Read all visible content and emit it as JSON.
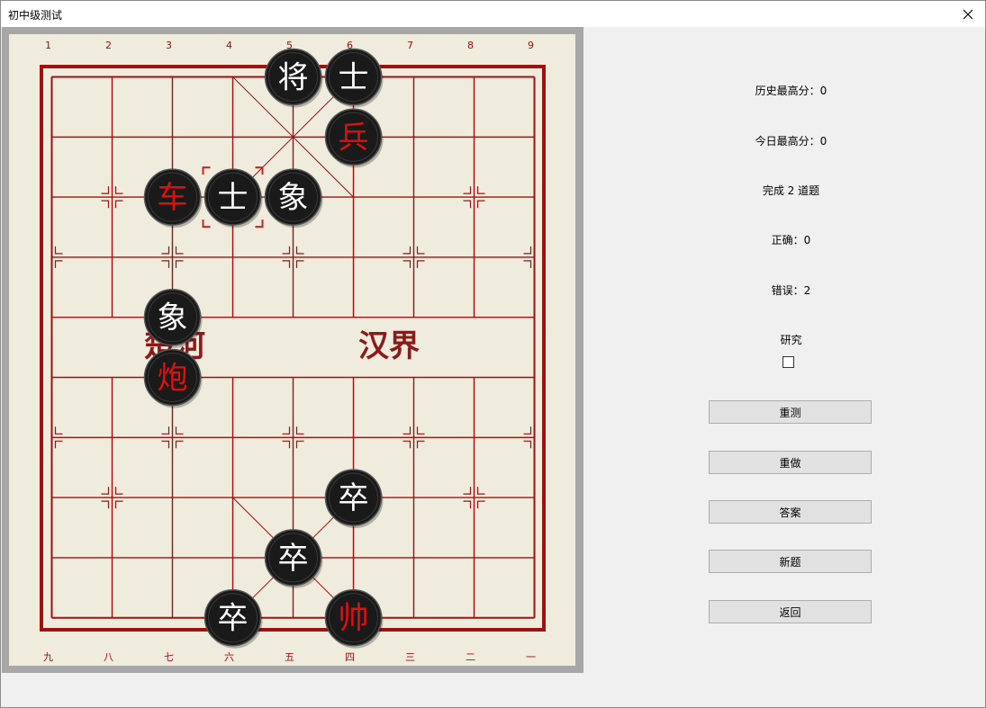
{
  "window": {
    "title": "初中级测试",
    "close_icon": "close-icon"
  },
  "board": {
    "top_file_labels": [
      "1",
      "2",
      "3",
      "4",
      "5",
      "6",
      "7",
      "8",
      "9"
    ],
    "bottom_file_labels": [
      "九",
      "八",
      "七",
      "六",
      "五",
      "四",
      "三",
      "二",
      "一"
    ],
    "river_left": "楚河",
    "river_right": "汉界",
    "colors": {
      "board_bg": "#efebdd",
      "line": "#a01010",
      "piece_body": "#1a1a1a",
      "black_text": "#ffffff",
      "red_text": "#e01010",
      "river_text": "#8c1a1a"
    },
    "pieces": [
      {
        "name": "black-general",
        "char": "将",
        "side": "black",
        "file": 5,
        "rank": 1
      },
      {
        "name": "black-advisor-top",
        "char": "士",
        "side": "black",
        "file": 6,
        "rank": 1
      },
      {
        "name": "red-soldier",
        "char": "兵",
        "side": "red",
        "file": 6,
        "rank": 2
      },
      {
        "name": "red-chariot",
        "char": "车",
        "side": "red",
        "file": 3,
        "rank": 3
      },
      {
        "name": "black-advisor-selected",
        "char": "士",
        "side": "black",
        "file": 4,
        "rank": 3,
        "selected": true
      },
      {
        "name": "black-elephant-top",
        "char": "象",
        "side": "black",
        "file": 5,
        "rank": 3
      },
      {
        "name": "black-elephant-river",
        "char": "象",
        "side": "black",
        "file": 3,
        "rank": 5
      },
      {
        "name": "red-cannon",
        "char": "炮",
        "side": "red",
        "file": 3,
        "rank": 6
      },
      {
        "name": "black-soldier-right",
        "char": "卒",
        "side": "black",
        "file": 6,
        "rank": 8
      },
      {
        "name": "black-soldier-center",
        "char": "卒",
        "side": "black",
        "file": 5,
        "rank": 9
      },
      {
        "name": "black-soldier-left",
        "char": "卒",
        "side": "black",
        "file": 4,
        "rank": 10
      },
      {
        "name": "red-general",
        "char": "帅",
        "side": "red",
        "file": 6,
        "rank": 10
      }
    ]
  },
  "panel": {
    "history_best": "历史最高分：0",
    "today_best": "今日最高分：0",
    "completed": "完成 2 道题",
    "correct": "正确：0",
    "wrong": "错误：2",
    "study_label": "研究",
    "study_checked": false,
    "buttons": {
      "retest": "重测",
      "redo": "重做",
      "answer": "答案",
      "new": "新题",
      "back": "返回"
    }
  }
}
